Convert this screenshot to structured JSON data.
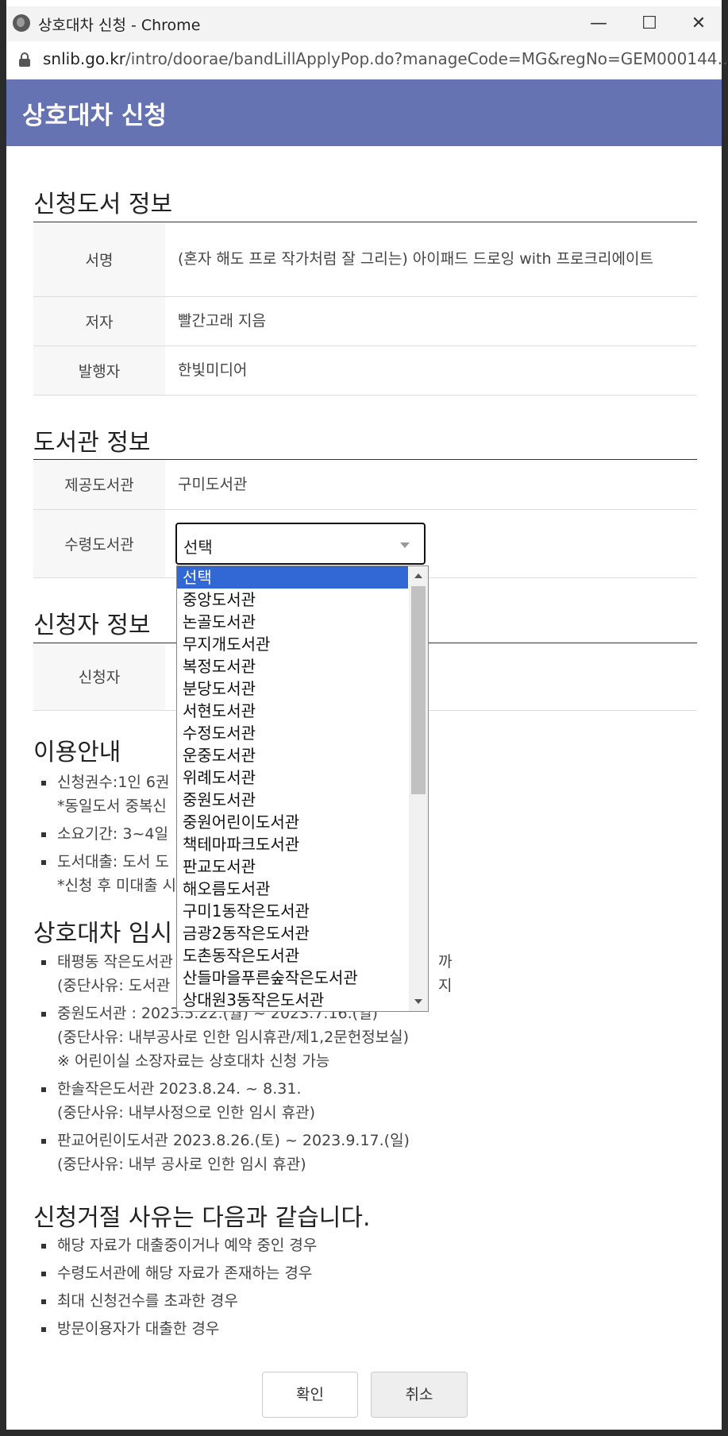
{
  "window": {
    "title": "상호대차 신청 - Chrome",
    "url_host": "snlib.go.kr",
    "url_path": "/intro/doorae/bandLillApplyPop.do?manageCode=MG&regNo=GEM000144…",
    "controls": {
      "minimize": "—",
      "maximize": "☐",
      "close": "✕"
    }
  },
  "header": {
    "title": "상호대차 신청"
  },
  "book_section": {
    "title": "신청도서 정보",
    "rows": [
      {
        "label": "서명",
        "value": "(혼자 해도 프로 작가처럼 잘 그리는) 아이패드 드로잉 with 프로크리에이트"
      },
      {
        "label": "저자",
        "value": "빨간고래 지음"
      },
      {
        "label": "발행자",
        "value": "한빛미디어"
      }
    ]
  },
  "library_section": {
    "title": "도서관 정보",
    "provider_label": "제공도서관",
    "provider_value": "구미도서관",
    "receiver_label": "수령도서관",
    "receiver_selected": "선택"
  },
  "dropdown": {
    "options": [
      "선택",
      "중앙도서관",
      "논골도서관",
      "무지개도서관",
      "복정도서관",
      "분당도서관",
      "서현도서관",
      "수정도서관",
      "운중도서관",
      "위례도서관",
      "중원도서관",
      "중원어린이도서관",
      "책테마파크도서관",
      "판교도서관",
      "해오름도서관",
      "구미1동작은도서관",
      "금광2동작은도서관",
      "도촌동작은도서관",
      "산들마을푸른숲작은도서관",
      "상대원3동작은도서관"
    ],
    "selected_index": 0
  },
  "applicant_section": {
    "title": "신청자 정보",
    "applicant_label": "신청자"
  },
  "usage": {
    "title": "이용안내",
    "items": [
      {
        "line1": "신청권수:1인 6권",
        "line2": "*동일도서 중복신"
      },
      {
        "line1": "소요기간: 3~4일",
        "line2": ""
      },
      {
        "line1": "도서대출: 도서 도",
        "line2": "*신청 후 미대출 시"
      }
    ]
  },
  "suspension": {
    "title": "상호대차 임시",
    "items": [
      {
        "line1": "태평동 작은도서관",
        "line1_tail": "까지",
        "line2": "(중단사유: 도서관",
        "line3": ""
      },
      {
        "line1": "중원도서관 : 2023.5.22.(월) ~ 2023.7.16.(일)",
        "line1_tail": "",
        "line2": "(중단사유: 내부공사로 인한 임시휴관/제1,2문헌정보실)",
        "line3": "※ 어린이실 소장자료는 상호대차 신청 가능"
      },
      {
        "line1": "한솔작은도서관 2023.8.24. ~ 8.31.",
        "line1_tail": "",
        "line2": "(중단사유: 내부사정으로 인한 임시 휴관)",
        "line3": ""
      },
      {
        "line1": "판교어린이도서관 2023.8.26.(토) ~ 2023.9.17.(일)",
        "line1_tail": "",
        "line2": "(중단사유: 내부 공사로 인한 임시 휴관)",
        "line3": ""
      }
    ]
  },
  "rejection": {
    "title": "신청거절 사유는 다음과 같습니다.",
    "items": [
      "해당 자료가 대출중이거나 예약 중인 경우",
      "수령도서관에 해당 자료가 존재하는 경우",
      "최대 신청건수를 초과한 경우",
      "방문이용자가 대출한 경우"
    ]
  },
  "buttons": {
    "confirm": "확인",
    "cancel": "취소"
  }
}
